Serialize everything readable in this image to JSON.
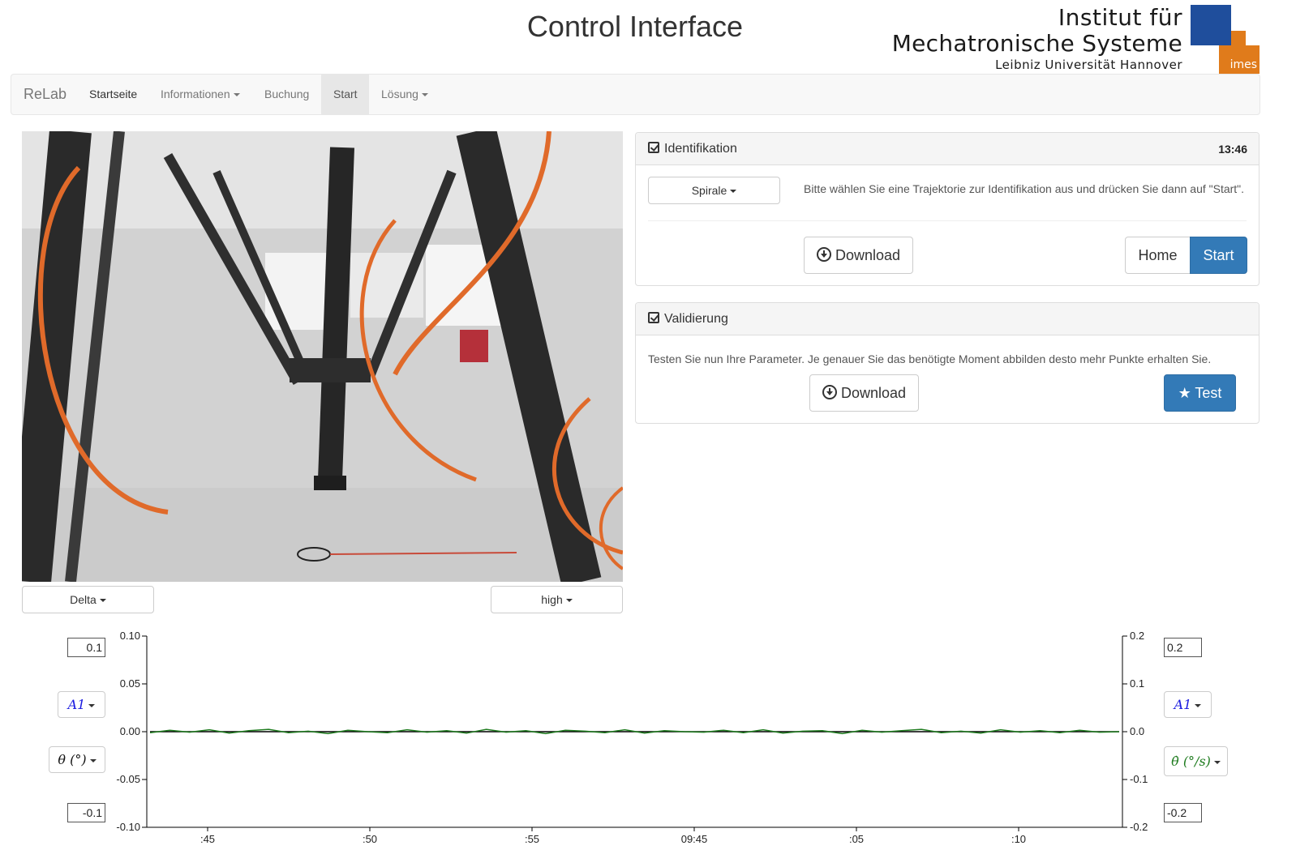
{
  "header": {
    "title": "Control Interface",
    "logo": {
      "line1": "Institut für",
      "line2": "Mechatronische Systeme",
      "line3": "Leibniz Universität Hannover",
      "mark_text": "imes",
      "colors": {
        "blue": "#1f4e9c",
        "orange": "#e07b1b"
      }
    }
  },
  "navbar": {
    "brand": "ReLab",
    "items": [
      {
        "label": "Startseite"
      },
      {
        "label": "Informationen",
        "dropdown": true
      },
      {
        "label": "Buchung"
      },
      {
        "label": "Start",
        "active": true
      },
      {
        "label": "Lösung",
        "dropdown": true
      }
    ]
  },
  "camera": {
    "view_select": "Delta",
    "quality_select": "high"
  },
  "identification": {
    "title": "Identifikation",
    "timer": "13:46",
    "trajectory_select": "Spirale",
    "help_text": "Bitte wählen Sie eine Trajektorie zur Identifikation aus und drücken Sie dann auf \"Start\".",
    "download_label": "Download",
    "home_label": "Home",
    "start_label": "Start"
  },
  "validation": {
    "title": "Validierung",
    "help_text": "Testen Sie nun Ihre Parameter. Je genauer Sie das benötigte Moment abbilden desto mehr Punkte erhalten Sie.",
    "download_label": "Download",
    "test_label": "Test"
  },
  "plot_controls": {
    "left_max": "0.1",
    "left_min": "-0.1",
    "right_max": "0.2",
    "right_min": "-0.2",
    "left_axis_select": "A1",
    "right_axis_select": "A1",
    "left_quantity": "θ (°)",
    "right_quantity": "θ̇ (°/s)"
  },
  "chart_data": {
    "type": "line",
    "x_tick_labels": [
      ":45",
      ":50",
      ":55",
      "09:45",
      ":05",
      ":10"
    ],
    "y_left": {
      "ticks": [
        "0.10",
        "0.05",
        "0.00",
        "-0.05",
        "-0.10"
      ],
      "ylim": [
        -0.1,
        0.1
      ]
    },
    "y_right": {
      "ticks": [
        "0.2",
        "0.1",
        "0.0",
        "-0.1",
        "-0.2"
      ],
      "ylim": [
        -0.2,
        0.2
      ]
    },
    "series": [
      {
        "axis": "left",
        "color": "#000000",
        "values": [
          0,
          0,
          0,
          0,
          0,
          0,
          0,
          0,
          0,
          0
        ]
      },
      {
        "axis": "right",
        "color": "#1e7b1e",
        "values": [
          -0.002,
          0.003,
          -0.001,
          0.004,
          -0.003,
          0.002,
          0.005,
          -0.002,
          0.001,
          -0.004,
          0.003,
          0.0,
          -0.002,
          0.004,
          -0.001,
          0.002,
          -0.003,
          0.005,
          -0.001,
          0.002,
          -0.004,
          0.003,
          0.001,
          -0.002,
          0.004,
          -0.003,
          0.002,
          0.0,
          -0.001,
          0.003,
          -0.002,
          0.004,
          -0.003,
          0.001,
          0.002,
          -0.004,
          0.003,
          -0.001,
          0.002,
          0.005,
          -0.002,
          0.001,
          -0.003,
          0.004,
          -0.001,
          0.002,
          -0.002,
          0.003,
          -0.001,
          0.0
        ]
      }
    ]
  }
}
